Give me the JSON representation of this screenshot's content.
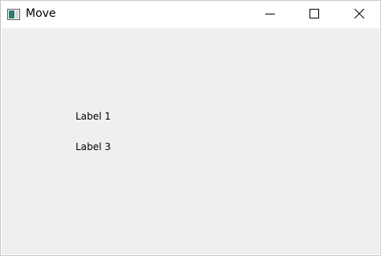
{
  "window": {
    "title": "Move",
    "icon": "window-app-icon"
  },
  "titlebar": {
    "minimize_icon": "minimize-icon",
    "maximize_icon": "maximize-icon",
    "close_icon": "close-icon"
  },
  "content": {
    "labels": [
      "Label 1",
      "Label 3"
    ]
  },
  "colors": {
    "client_background": "#efefef",
    "titlebar_background": "#ffffff"
  }
}
